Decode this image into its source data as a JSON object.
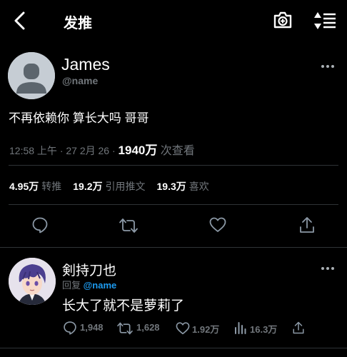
{
  "header": {
    "title": "发推",
    "back_icon": "back-chevron-icon",
    "camera_icon": "camera-plus-icon",
    "sort_icon": "sort-order-icon"
  },
  "tweet": {
    "author_name": "James",
    "author_handle": "@name",
    "text": "不再依赖你 算长大吗 哥哥",
    "time": "12:58 上午 · 27 2月 26 · ",
    "views_count": "1940万",
    "views_label": " 次查看",
    "stats": [
      {
        "count": "4.95万",
        "label": "转推"
      },
      {
        "count": "19.2万",
        "label": "引用推文"
      },
      {
        "count": "19.3万",
        "label": "喜欢"
      }
    ],
    "actions": [
      "reply-icon",
      "retweet-icon",
      "like-icon",
      "share-icon"
    ]
  },
  "reply": {
    "author_name": "剣持刀也",
    "reply_prefix": "回复 ",
    "reply_mention": "@name",
    "text": "长大了就不是萝莉了",
    "replies": "1,948",
    "retweets": "1,628",
    "likes": "1.92万",
    "views": "16.3万"
  },
  "colors": {
    "background": "#000000",
    "text": "#e7e9ea",
    "muted": "#71767b",
    "accent": "#1d9bf0",
    "divider": "#2f3336"
  }
}
